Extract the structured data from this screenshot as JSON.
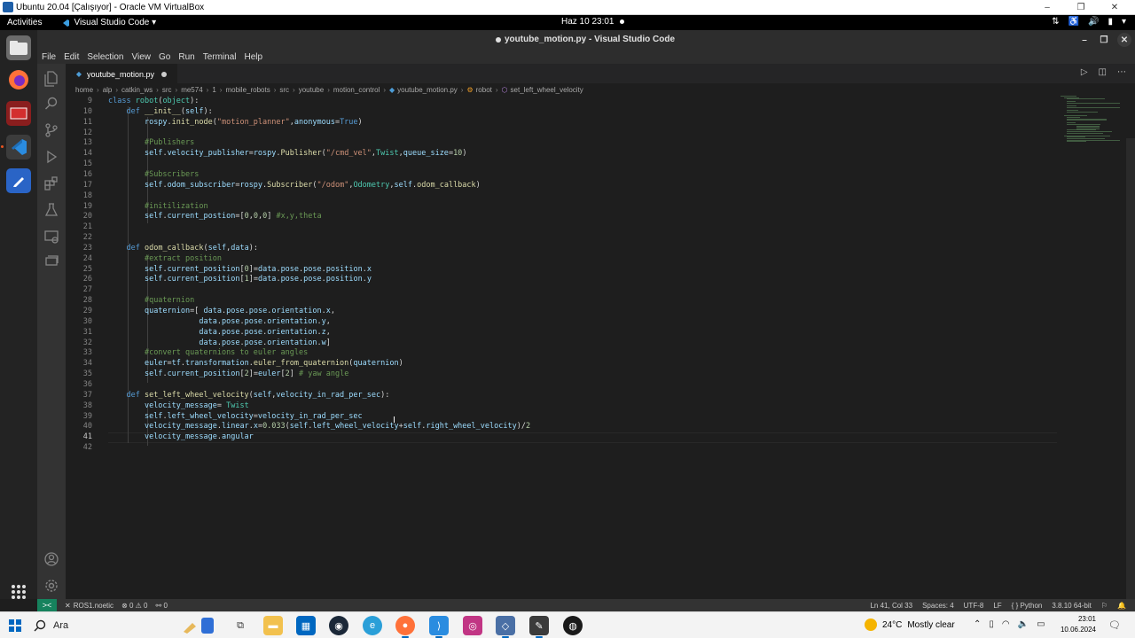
{
  "vbox": {
    "title": "Ubuntu 20.04 [Çalışıyor] - Oracle VM VirtualBox",
    "controls": [
      "–",
      "❐",
      "✕"
    ]
  },
  "gnome": {
    "activities": "Activities",
    "app_menu": "Visual Studio Code ▾",
    "clock": "Haz 10  23:01"
  },
  "vscode": {
    "window_title": "youtube_motion.py - Visual Studio Code",
    "menu": [
      "File",
      "Edit",
      "Selection",
      "View",
      "Go",
      "Run",
      "Terminal",
      "Help"
    ],
    "tab_label": "youtube_motion.py",
    "breadcrumb": [
      "home",
      "alp",
      "catkin_ws",
      "src",
      "me574",
      "1",
      "mobile_robots",
      "src",
      "youtube",
      "motion_control",
      "youtube_motion.py",
      "robot",
      "set_left_wheel_velocity"
    ],
    "line_numbers": [
      "9",
      "10",
      "11",
      "12",
      "13",
      "14",
      "15",
      "16",
      "17",
      "18",
      "19",
      "20",
      "21",
      "22",
      "23",
      "24",
      "25",
      "26",
      "27",
      "28",
      "29",
      "30",
      "31",
      "32",
      "33",
      "34",
      "35",
      "36",
      "37",
      "38",
      "39",
      "40",
      "41",
      "42"
    ],
    "current_line": "41",
    "code_lines": [
      [
        [
          "kw",
          "class "
        ],
        [
          "cls",
          "robot"
        ],
        [
          "pl",
          "("
        ],
        [
          "cls",
          "object"
        ],
        [
          "pl",
          "):"
        ]
      ],
      [
        [
          "pl",
          "    "
        ],
        [
          "kw",
          "def "
        ],
        [
          "fn",
          "__init__"
        ],
        [
          "pl",
          "("
        ],
        [
          "var",
          "self"
        ],
        [
          "pl",
          "):"
        ]
      ],
      [
        [
          "pl",
          "        "
        ],
        [
          "var",
          "rospy"
        ],
        [
          "pl",
          "."
        ],
        [
          "fn",
          "init_node"
        ],
        [
          "pl",
          "("
        ],
        [
          "str",
          "\"motion_planner\""
        ],
        [
          "pl",
          ","
        ],
        [
          "var",
          "anonymous"
        ],
        [
          "pl",
          "="
        ],
        [
          "kw",
          "True"
        ],
        [
          "pl",
          ")"
        ]
      ],
      [
        [
          "pl",
          ""
        ]
      ],
      [
        [
          "pl",
          "        "
        ],
        [
          "cm",
          "#Publishers"
        ]
      ],
      [
        [
          "pl",
          "        "
        ],
        [
          "var",
          "self"
        ],
        [
          "pl",
          "."
        ],
        [
          "var",
          "velocity_publisher"
        ],
        [
          "pl",
          "="
        ],
        [
          "var",
          "rospy"
        ],
        [
          "pl",
          "."
        ],
        [
          "fn",
          "Publisher"
        ],
        [
          "pl",
          "("
        ],
        [
          "str",
          "\"/cmd_vel\""
        ],
        [
          "pl",
          ","
        ],
        [
          "cls",
          "Twist"
        ],
        [
          "pl",
          ","
        ],
        [
          "var",
          "queue_size"
        ],
        [
          "pl",
          "="
        ],
        [
          "num",
          "10"
        ],
        [
          "pl",
          ")"
        ]
      ],
      [
        [
          "pl",
          ""
        ]
      ],
      [
        [
          "pl",
          "        "
        ],
        [
          "cm",
          "#Subscribers"
        ]
      ],
      [
        [
          "pl",
          "        "
        ],
        [
          "var",
          "self"
        ],
        [
          "pl",
          "."
        ],
        [
          "var",
          "odom_subscriber"
        ],
        [
          "pl",
          "="
        ],
        [
          "var",
          "rospy"
        ],
        [
          "pl",
          "."
        ],
        [
          "fn",
          "Subscriber"
        ],
        [
          "pl",
          "("
        ],
        [
          "str",
          "\"/odom\""
        ],
        [
          "pl",
          ","
        ],
        [
          "cls",
          "Odometry"
        ],
        [
          "pl",
          ","
        ],
        [
          "var",
          "self"
        ],
        [
          "pl",
          "."
        ],
        [
          "fn",
          "odom_callback"
        ],
        [
          "pl",
          ")"
        ]
      ],
      [
        [
          "pl",
          ""
        ]
      ],
      [
        [
          "pl",
          "        "
        ],
        [
          "cm",
          "#initilization"
        ]
      ],
      [
        [
          "pl",
          "        "
        ],
        [
          "var",
          "self"
        ],
        [
          "pl",
          "."
        ],
        [
          "var",
          "current_postion"
        ],
        [
          "pl",
          "=["
        ],
        [
          "num",
          "0"
        ],
        [
          "pl",
          ","
        ],
        [
          "num",
          "0"
        ],
        [
          "pl",
          ","
        ],
        [
          "num",
          "0"
        ],
        [
          "pl",
          "] "
        ],
        [
          "cm",
          "#x,y,theta"
        ]
      ],
      [
        [
          "pl",
          ""
        ]
      ],
      [
        [
          "pl",
          ""
        ]
      ],
      [
        [
          "pl",
          "    "
        ],
        [
          "kw",
          "def "
        ],
        [
          "fn",
          "odom_callback"
        ],
        [
          "pl",
          "("
        ],
        [
          "var",
          "self"
        ],
        [
          "pl",
          ","
        ],
        [
          "var",
          "data"
        ],
        [
          "pl",
          "):"
        ]
      ],
      [
        [
          "pl",
          "        "
        ],
        [
          "cm",
          "#extract position"
        ]
      ],
      [
        [
          "pl",
          "        "
        ],
        [
          "var",
          "self"
        ],
        [
          "pl",
          "."
        ],
        [
          "var",
          "current_position"
        ],
        [
          "pl",
          "["
        ],
        [
          "num",
          "0"
        ],
        [
          "pl",
          "]="
        ],
        [
          "var",
          "data"
        ],
        [
          "pl",
          "."
        ],
        [
          "var",
          "pose"
        ],
        [
          "pl",
          "."
        ],
        [
          "var",
          "pose"
        ],
        [
          "pl",
          "."
        ],
        [
          "var",
          "position"
        ],
        [
          "pl",
          "."
        ],
        [
          "var",
          "x"
        ]
      ],
      [
        [
          "pl",
          "        "
        ],
        [
          "var",
          "self"
        ],
        [
          "pl",
          "."
        ],
        [
          "var",
          "current_position"
        ],
        [
          "pl",
          "["
        ],
        [
          "num",
          "1"
        ],
        [
          "pl",
          "]="
        ],
        [
          "var",
          "data"
        ],
        [
          "pl",
          "."
        ],
        [
          "var",
          "pose"
        ],
        [
          "pl",
          "."
        ],
        [
          "var",
          "pose"
        ],
        [
          "pl",
          "."
        ],
        [
          "var",
          "position"
        ],
        [
          "pl",
          "."
        ],
        [
          "var",
          "y"
        ]
      ],
      [
        [
          "pl",
          ""
        ]
      ],
      [
        [
          "pl",
          "        "
        ],
        [
          "cm",
          "#quaternion"
        ]
      ],
      [
        [
          "pl",
          "        "
        ],
        [
          "var",
          "quaternion"
        ],
        [
          "pl",
          "=[ "
        ],
        [
          "var",
          "data"
        ],
        [
          "pl",
          "."
        ],
        [
          "var",
          "pose"
        ],
        [
          "pl",
          "."
        ],
        [
          "var",
          "pose"
        ],
        [
          "pl",
          "."
        ],
        [
          "var",
          "orientation"
        ],
        [
          "pl",
          "."
        ],
        [
          "var",
          "x"
        ],
        [
          "pl",
          ","
        ]
      ],
      [
        [
          "pl",
          "                    "
        ],
        [
          "var",
          "data"
        ],
        [
          "pl",
          "."
        ],
        [
          "var",
          "pose"
        ],
        [
          "pl",
          "."
        ],
        [
          "var",
          "pose"
        ],
        [
          "pl",
          "."
        ],
        [
          "var",
          "orientation"
        ],
        [
          "pl",
          "."
        ],
        [
          "var",
          "y"
        ],
        [
          "pl",
          ","
        ]
      ],
      [
        [
          "pl",
          "                    "
        ],
        [
          "var",
          "data"
        ],
        [
          "pl",
          "."
        ],
        [
          "var",
          "pose"
        ],
        [
          "pl",
          "."
        ],
        [
          "var",
          "pose"
        ],
        [
          "pl",
          "."
        ],
        [
          "var",
          "orientation"
        ],
        [
          "pl",
          "."
        ],
        [
          "var",
          "z"
        ],
        [
          "pl",
          ","
        ]
      ],
      [
        [
          "pl",
          "                    "
        ],
        [
          "var",
          "data"
        ],
        [
          "pl",
          "."
        ],
        [
          "var",
          "pose"
        ],
        [
          "pl",
          "."
        ],
        [
          "var",
          "pose"
        ],
        [
          "pl",
          "."
        ],
        [
          "var",
          "orientation"
        ],
        [
          "pl",
          "."
        ],
        [
          "var",
          "w"
        ],
        [
          "pl",
          "]"
        ]
      ],
      [
        [
          "pl",
          "        "
        ],
        [
          "cm",
          "#convert quaternions to euler angles"
        ]
      ],
      [
        [
          "pl",
          "        "
        ],
        [
          "var",
          "euler"
        ],
        [
          "pl",
          "="
        ],
        [
          "var",
          "tf"
        ],
        [
          "pl",
          "."
        ],
        [
          "var",
          "transformation"
        ],
        [
          "pl",
          "."
        ],
        [
          "fn",
          "euler_from_quaternion"
        ],
        [
          "pl",
          "("
        ],
        [
          "var",
          "quaternion"
        ],
        [
          "pl",
          ")"
        ]
      ],
      [
        [
          "pl",
          "        "
        ],
        [
          "var",
          "self"
        ],
        [
          "pl",
          "."
        ],
        [
          "var",
          "current_position"
        ],
        [
          "pl",
          "["
        ],
        [
          "num",
          "2"
        ],
        [
          "pl",
          "]="
        ],
        [
          "var",
          "euler"
        ],
        [
          "pl",
          "["
        ],
        [
          "num",
          "2"
        ],
        [
          "pl",
          "] "
        ],
        [
          "cm",
          "# yaw angle"
        ]
      ],
      [
        [
          "pl",
          ""
        ]
      ],
      [
        [
          "pl",
          "    "
        ],
        [
          "kw",
          "def "
        ],
        [
          "fn",
          "set_left_wheel_velocity"
        ],
        [
          "pl",
          "("
        ],
        [
          "var",
          "self"
        ],
        [
          "pl",
          ","
        ],
        [
          "var",
          "velocity_in_rad_per_sec"
        ],
        [
          "pl",
          "):"
        ]
      ],
      [
        [
          "pl",
          "        "
        ],
        [
          "var",
          "velocity_message"
        ],
        [
          "pl",
          "= "
        ],
        [
          "cls",
          "Twist"
        ]
      ],
      [
        [
          "pl",
          "        "
        ],
        [
          "var",
          "self"
        ],
        [
          "pl",
          "."
        ],
        [
          "var",
          "left_wheel_velocity"
        ],
        [
          "pl",
          "="
        ],
        [
          "var",
          "velocity_in_rad_per_sec"
        ]
      ],
      [
        [
          "pl",
          "        "
        ],
        [
          "var",
          "velocity_message"
        ],
        [
          "pl",
          "."
        ],
        [
          "var",
          "linear"
        ],
        [
          "pl",
          "."
        ],
        [
          "var",
          "x"
        ],
        [
          "pl",
          "="
        ],
        [
          "num",
          "0.033"
        ],
        [
          "pl",
          "("
        ],
        [
          "var",
          "self"
        ],
        [
          "pl",
          "."
        ],
        [
          "var",
          "left_wheel_velocity"
        ],
        [
          "pl",
          "+"
        ],
        [
          "var",
          "self"
        ],
        [
          "pl",
          "."
        ],
        [
          "var",
          "right_wheel_velocity"
        ],
        [
          "pl",
          ")/"
        ],
        [
          "num",
          "2"
        ]
      ],
      [
        [
          "pl",
          "        "
        ],
        [
          "var",
          "velocity_message"
        ],
        [
          "pl",
          "."
        ],
        [
          "var",
          "angular"
        ]
      ],
      [
        [
          "pl",
          ""
        ]
      ]
    ]
  },
  "status": {
    "remote": "><",
    "branch": "ROS1.noetic",
    "problems": "⊗ 0 ⚠ 0",
    "ports": "⚯ 0",
    "right_items": [
      "Ln 41, Col 33",
      "Spaces: 4",
      "UTF-8",
      "LF",
      "{ } Python",
      "3.8.10 64-bit",
      "⚐",
      "🔔"
    ]
  },
  "taskbar": {
    "search": "Ara",
    "weather_temp": "24°C",
    "weather_desc": "Mostly clear",
    "time": "23:01",
    "date": "10.06.2024"
  },
  "colors": {
    "kw": "#569cd6",
    "cls": "#4ec9b0",
    "fn": "#dcdcaa",
    "var": "#9cdcfe",
    "str": "#ce9178",
    "num": "#b5cea8",
    "cm": "#6a9955",
    "pl": "#d4d4d4"
  }
}
